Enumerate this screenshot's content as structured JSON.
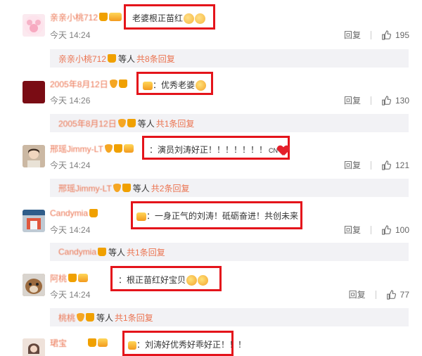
{
  "comments": [
    {
      "user": "亲亲小桃712",
      "text": "老婆根正苗红",
      "time": "今天 14:24",
      "reply_label": "回复",
      "likes": "195",
      "sub_user": "亲亲小桃712",
      "sub_mid": "等人",
      "sub_more": "共8条回复"
    },
    {
      "user": "2005年8月12日",
      "text": "：优秀老婆",
      "time": "今天 14:26",
      "reply_label": "回复",
      "likes": "130",
      "sub_user": "2005年8月12日",
      "sub_mid": "等人",
      "sub_more": "共1条回复"
    },
    {
      "user": "邢瑶Jimmy-LT",
      "text": "：演员刘涛好正！！！！！！！",
      "text_tail": "CN",
      "time": "今天 14:24",
      "reply_label": "回复",
      "likes": "121",
      "sub_user": "邢瑶Jimmy-LT",
      "sub_mid": "等人",
      "sub_more": "共2条回复"
    },
    {
      "user": "Candymia",
      "text": "：一身正气的刘涛！砥砺奋进！共创未来",
      "time": "今天 14:24",
      "reply_label": "回复",
      "likes": "100",
      "sub_user": "Candymia",
      "sub_mid": "等人",
      "sub_more": "共1条回复"
    },
    {
      "user": "阿桃",
      "text": "：根正苗红好宝贝",
      "time": "今天 14:24",
      "reply_label": "回复",
      "likes": "77",
      "sub_user": "桃桃",
      "sub_mid": "等人",
      "sub_more": "共1条回复"
    },
    {
      "user": "珺宝",
      "text": "：刘涛好优秀好乖好正！！！"
    }
  ],
  "colors": {
    "accent": "#eb7350",
    "highlight": "#e4141b",
    "sub_bg": "#f2f2f5"
  }
}
